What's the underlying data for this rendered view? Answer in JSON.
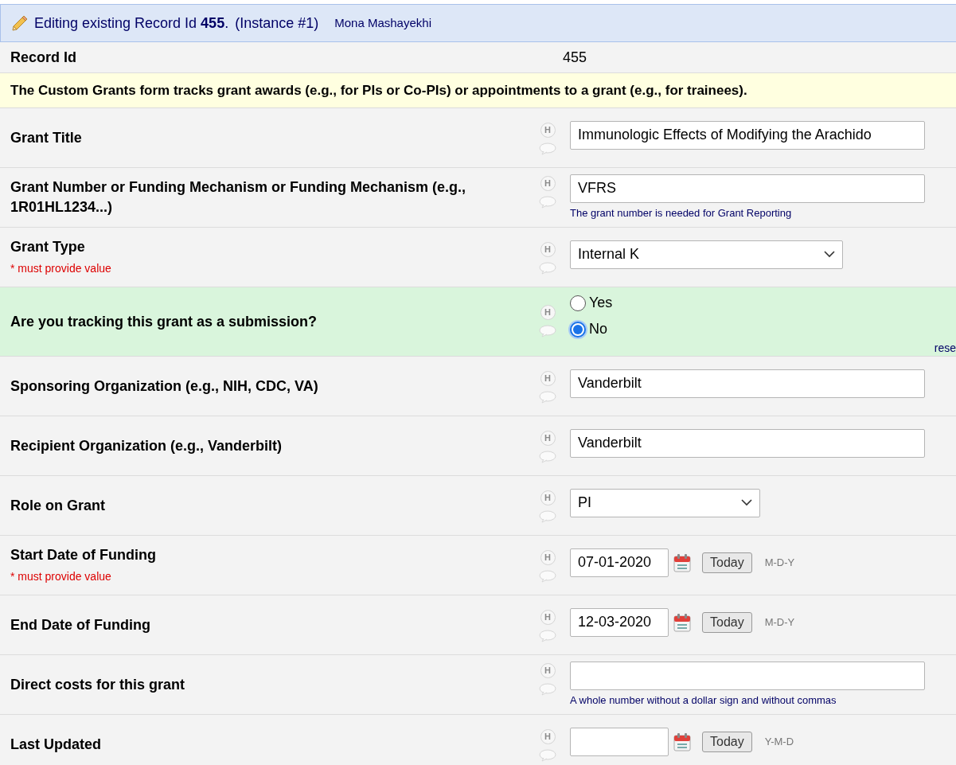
{
  "header": {
    "text": "Editing existing Record Id **455**.",
    "instance": "(Instance #1)",
    "user": "Mona Mashayekhi"
  },
  "record_id": {
    "label": "Record Id",
    "value": "455"
  },
  "description": "The Custom Grants form tracks grant awards (e.g., for PIs or Co-PIs) or appointments to a grant (e.g., for trainees).",
  "fields": [
    {
      "kind": "text",
      "label": "Grant Title",
      "history": "H",
      "value": "Immunologic Effects of Modifying the Arachido"
    },
    {
      "kind": "text",
      "label": "Grant Number or Funding Mechanism or Funding Mechanism (e.g., 1R01HL1234...)",
      "history": "H",
      "value": "VFRS",
      "note": "The grant number is needed for Grant Reporting"
    },
    {
      "kind": "select",
      "label": "Grant Type",
      "required": "* must provide value",
      "history": "H",
      "value": "Internal K"
    },
    {
      "kind": "radio",
      "label": "Are you tracking this grant as a submission?",
      "history": "H",
      "options": [
        {
          "label": "Yes",
          "selected": false
        },
        {
          "label": "No",
          "selected": true
        }
      ],
      "reset": "rese"
    },
    {
      "kind": "text",
      "label": "Sponsoring Organization (e.g., NIH, CDC, VA)",
      "history": "H",
      "value": "Vanderbilt"
    },
    {
      "kind": "text",
      "label": "Recipient Organization (e.g., Vanderbilt)",
      "history": "H",
      "value": "Vanderbilt"
    },
    {
      "kind": "select",
      "label": "Role on Grant",
      "history": "H",
      "value": "PI"
    },
    {
      "kind": "date",
      "label": "Start Date of Funding",
      "required": "* must provide value",
      "history": "H",
      "value": "07-01-2020",
      "button": "Today",
      "format": "M-D-Y"
    },
    {
      "kind": "date",
      "label": "End Date of Funding",
      "history": "H",
      "value": "12-03-2020",
      "button": "Today",
      "format": "M-D-Y"
    },
    {
      "kind": "text",
      "label": "Direct costs for this grant",
      "history": "H",
      "note": "A whole number without a dollar sign and without commas"
    },
    {
      "kind": "date",
      "label": "Last Updated",
      "history": "H",
      "button": "Today",
      "format": "Y-M-D"
    }
  ]
}
